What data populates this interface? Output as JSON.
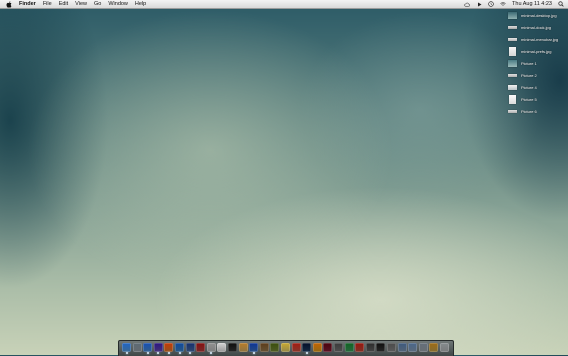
{
  "menubar": {
    "app": "Finder",
    "items": [
      "File",
      "Edit",
      "View",
      "Go",
      "Window",
      "Help"
    ],
    "clock": "Thu  Aug 11  4:23",
    "status_icons": [
      "cloud-icon",
      "play-icon",
      "time-machine-icon",
      "wifi-icon"
    ]
  },
  "desktop_files": [
    {
      "name": "minimal-desktop.jpg",
      "thumb_color": "#5e8a90"
    },
    {
      "name": "minimal-dock.jpg",
      "thumb_color": "#c8c8c8"
    },
    {
      "name": "minimal-menubar.jpg",
      "thumb_color": "#bcbcbc"
    },
    {
      "name": "minimal-prefs.jpg",
      "thumb_color": "#e8e8e8"
    },
    {
      "name": "Picture 1",
      "thumb_color": "#6b8f92"
    },
    {
      "name": "Picture 2",
      "thumb_color": "#cfcfcf"
    },
    {
      "name": "Picture 4",
      "thumb_color": "#d6dde0"
    },
    {
      "name": "Picture 5",
      "thumb_color": "#ededed"
    },
    {
      "name": "Picture 6",
      "thumb_color": "#cfcfcf"
    }
  ],
  "dock": {
    "apps": [
      {
        "name": "finder-icon",
        "color": "#5aa0e0",
        "running": true
      },
      {
        "name": "activity-icon",
        "color": "#9aa4ac",
        "running": false
      },
      {
        "name": "safari-icon",
        "color": "#4d8fd6",
        "running": true
      },
      {
        "name": "itunes-icon",
        "color": "#6a4bb6",
        "running": true
      },
      {
        "name": "firefox-icon",
        "color": "#e07b2a",
        "running": true
      },
      {
        "name": "network-icon",
        "color": "#3e88c8",
        "running": true
      },
      {
        "name": "app-icon",
        "color": "#4a6fa8",
        "running": true
      },
      {
        "name": "mail-icon",
        "color": "#b84040",
        "running": false
      },
      {
        "name": "app-icon",
        "color": "#c0c0c0",
        "running": true
      },
      {
        "name": "calendar-icon",
        "color": "#e8e8e8",
        "running": false
      },
      {
        "name": "app-icon",
        "color": "#3a3a3a",
        "running": false
      },
      {
        "name": "preview-icon",
        "color": "#d9b266",
        "running": false
      },
      {
        "name": "app-icon",
        "color": "#3a74c4",
        "running": true
      },
      {
        "name": "app-icon",
        "color": "#9a7d52",
        "running": false
      },
      {
        "name": "app-icon",
        "color": "#7a8d3a",
        "running": false
      },
      {
        "name": "app-icon",
        "color": "#e2d070",
        "running": false
      },
      {
        "name": "app-icon",
        "color": "#cc5544",
        "running": false
      },
      {
        "name": "photoshop-icon",
        "color": "#1e3f66",
        "running": true
      },
      {
        "name": "illustrator-icon",
        "color": "#e0a020",
        "running": false
      },
      {
        "name": "indesign-icon",
        "color": "#8a1e3a",
        "running": false
      },
      {
        "name": "app-icon",
        "color": "#7a7a7a",
        "running": false
      },
      {
        "name": "app-icon",
        "color": "#3f9f5f",
        "running": false
      },
      {
        "name": "app-icon",
        "color": "#c44c3c",
        "running": false
      },
      {
        "name": "app-icon",
        "color": "#6a6a6a",
        "running": false
      },
      {
        "name": "app-icon",
        "color": "#3c3c3c",
        "running": false
      },
      {
        "name": "app-icon",
        "color": "#8a8a8a",
        "running": false
      },
      {
        "name": "applications-folder-icon",
        "color": "#7f98b4",
        "running": false
      },
      {
        "name": "documents-folder-icon",
        "color": "#8aa2bc",
        "running": false
      },
      {
        "name": "downloads-folder-icon",
        "color": "#a0a8b0",
        "running": false
      },
      {
        "name": "folder-icon",
        "color": "#c9a64a",
        "running": false
      },
      {
        "name": "trash-icon",
        "color": "#b8bcbe",
        "running": false
      }
    ]
  }
}
